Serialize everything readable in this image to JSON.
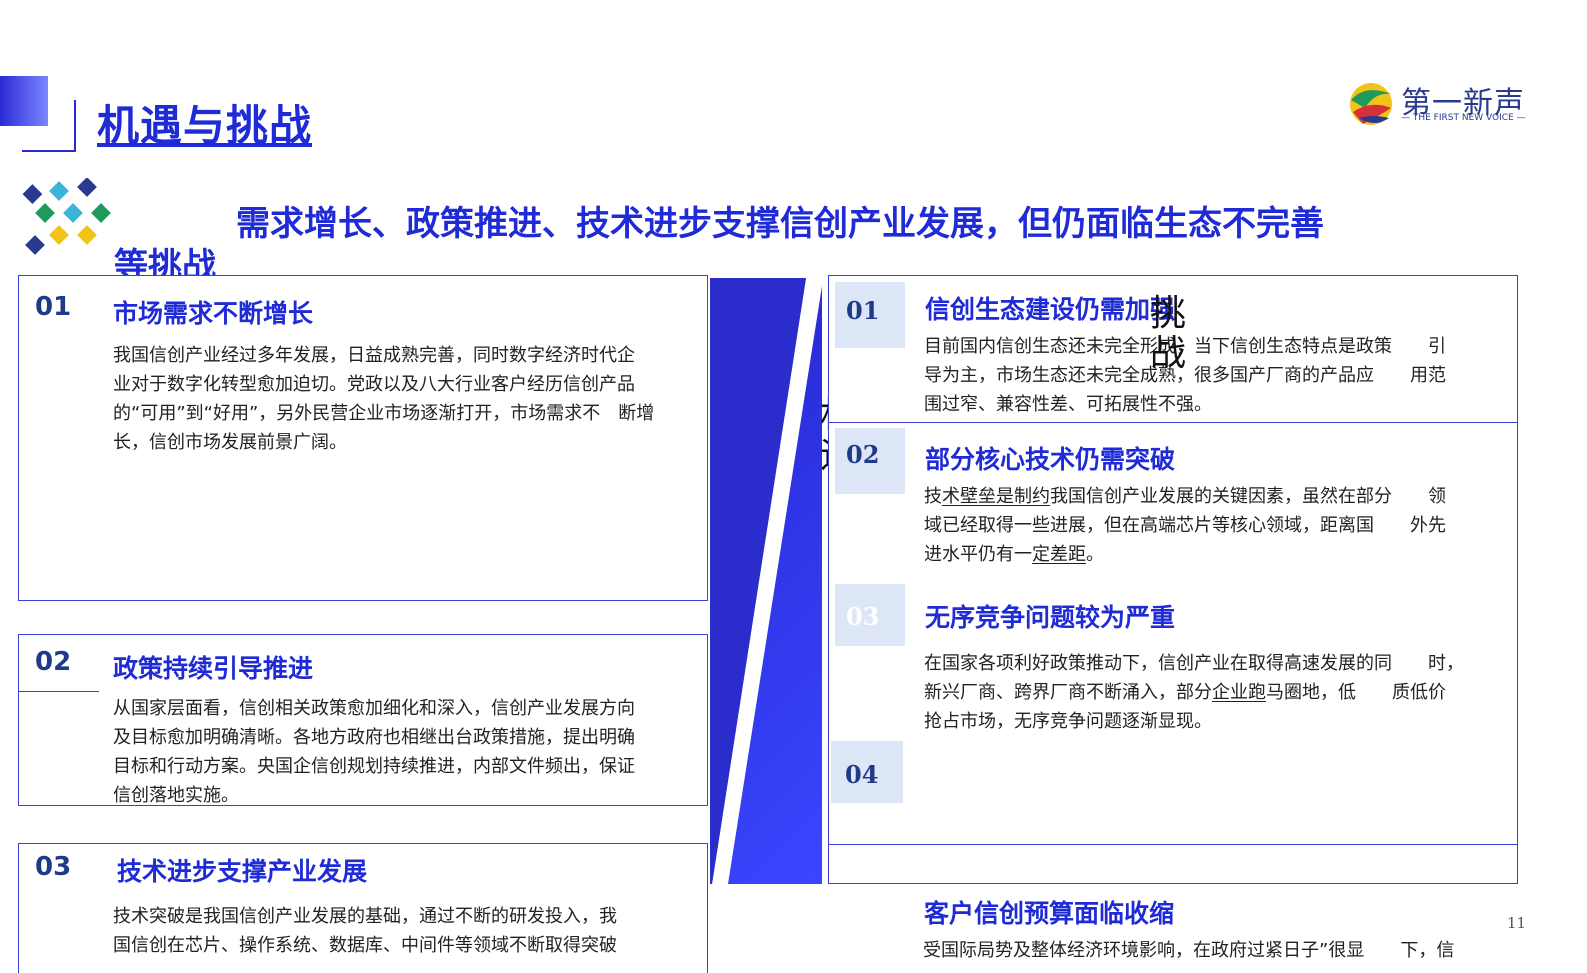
{
  "header": {
    "title": "机遇与挑战",
    "brand_name": "第一新声",
    "brand_tagline": "— THE FIRST NEW VOICE —"
  },
  "subtitle": {
    "line1": "需求增长、政策推进、技术进步支撑信创产业发展，但仍面临生态不完善",
    "line2": "等挑战"
  },
  "divider": {
    "left_label_chars": [
      "机",
      "遇"
    ],
    "right_label_chars": [
      "挑",
      "战"
    ]
  },
  "opportunities": [
    {
      "num": "01",
      "title": "市场需求不断增长",
      "lines": [
        "我国信创产业经过多年发展，日益成熟完善，同时数字经济时代企",
        "业对于数字化转型愈加迫切。党政以及八大行业客户经历信创产品",
        "的“可用”到“好用”，另外民营企业市场逐渐打开，市场需求不　断增",
        "长，信创市场发展前景广阔。"
      ]
    },
    {
      "num": "02",
      "title": "政策持续引导推进",
      "lines": [
        "从国家层面看，信创相关政策愈加细化和深入，信创产业发展方向",
        "及目标愈加明确清晰。各地方政府也相继出台政策措施，提出明确",
        "目标和行动方案。央国企信创规划持续推进，内部文件频出，保证",
        "信创落地实施。"
      ]
    },
    {
      "num": "03",
      "title": "技术进步支撑产业发展",
      "lines": [
        "技术突破是我国信创产业发展的基础，通过不断的研发投入，我",
        "国信创在芯片、操作系统、数据库、中间件等领域不断取得突破"
      ]
    }
  ],
  "challenges": [
    {
      "num": "01",
      "title": "信创生态建设仍需加强",
      "lines": [
        "目前国内信创生态还未完全形成，当下信创生态特点是政策　　引",
        "导为主，市场生态还未完全成熟，很多国产厂商的产品应　　用范",
        "围过窄、兼容性差、可拓展性不强。"
      ]
    },
    {
      "num": "02",
      "title": "部分核心技术仍需突破",
      "line1_a": "技",
      "line1_u": "术壁垒是制约",
      "line1_b": "我国信创产业发展的关键因素，虽然在部分　　领",
      "line2": "域已经取得一些进展，但在高端芯片等核心领域，距离国　　外先",
      "line3_a": "进水平仍有一",
      "line3_u": "定差距",
      "line3_b": "。"
    },
    {
      "num": "03",
      "title": "无序竞争问题较为严重",
      "line1": "在国家各项利好政策推动下，信创产业在取得高速发展的同　　时，",
      "line2_a": "新兴厂商、跨界厂商不断涌入，部分",
      "line2_u": "企业跑",
      "line2_b": "马圈地，低　　质低价",
      "line3": "抢占市场，无序竞争问题逐渐显现。"
    },
    {
      "num": "04",
      "title": "客户信创预算面临收缩",
      "lines": [
        "受国际局势及整体经济环境影响，在政府过紧日子”很显　　下，信"
      ]
    }
  ],
  "page_number": "11",
  "colors": {
    "accent": "#1f2bd6",
    "number": "#1f3a8a",
    "number_bg": "#dde6f7"
  }
}
